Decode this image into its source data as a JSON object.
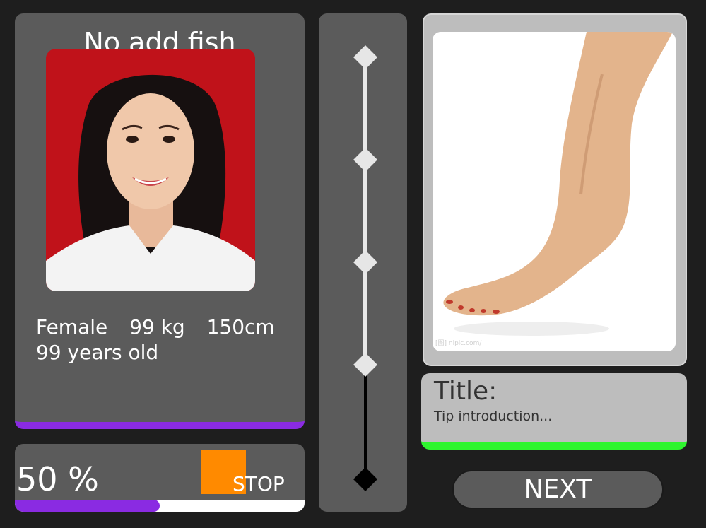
{
  "profile": {
    "name": "No add fish",
    "gender": "Female",
    "weight": "99 kg",
    "height": "150cm",
    "age": "99 years old"
  },
  "progress": {
    "value_label": "50 %",
    "fraction": 0.5,
    "stop_label": "STOP"
  },
  "slider": {
    "handle_count": 5,
    "level": 3
  },
  "right_image": {
    "watermark": "[图] nipic.com/"
  },
  "tip": {
    "title": "Title:",
    "text": "Tip introduction..."
  },
  "next_button": {
    "label": "NEXT"
  },
  "colors": {
    "background": "#1e1e1e",
    "panel": "#5b5b5b",
    "accent_purple": "#8a2be2",
    "accent_green": "#2ef52e",
    "stop_orange": "#ff8a00",
    "light_panel": "#bdbdbd"
  },
  "icons": [
    "diamond-handle-icon"
  ]
}
